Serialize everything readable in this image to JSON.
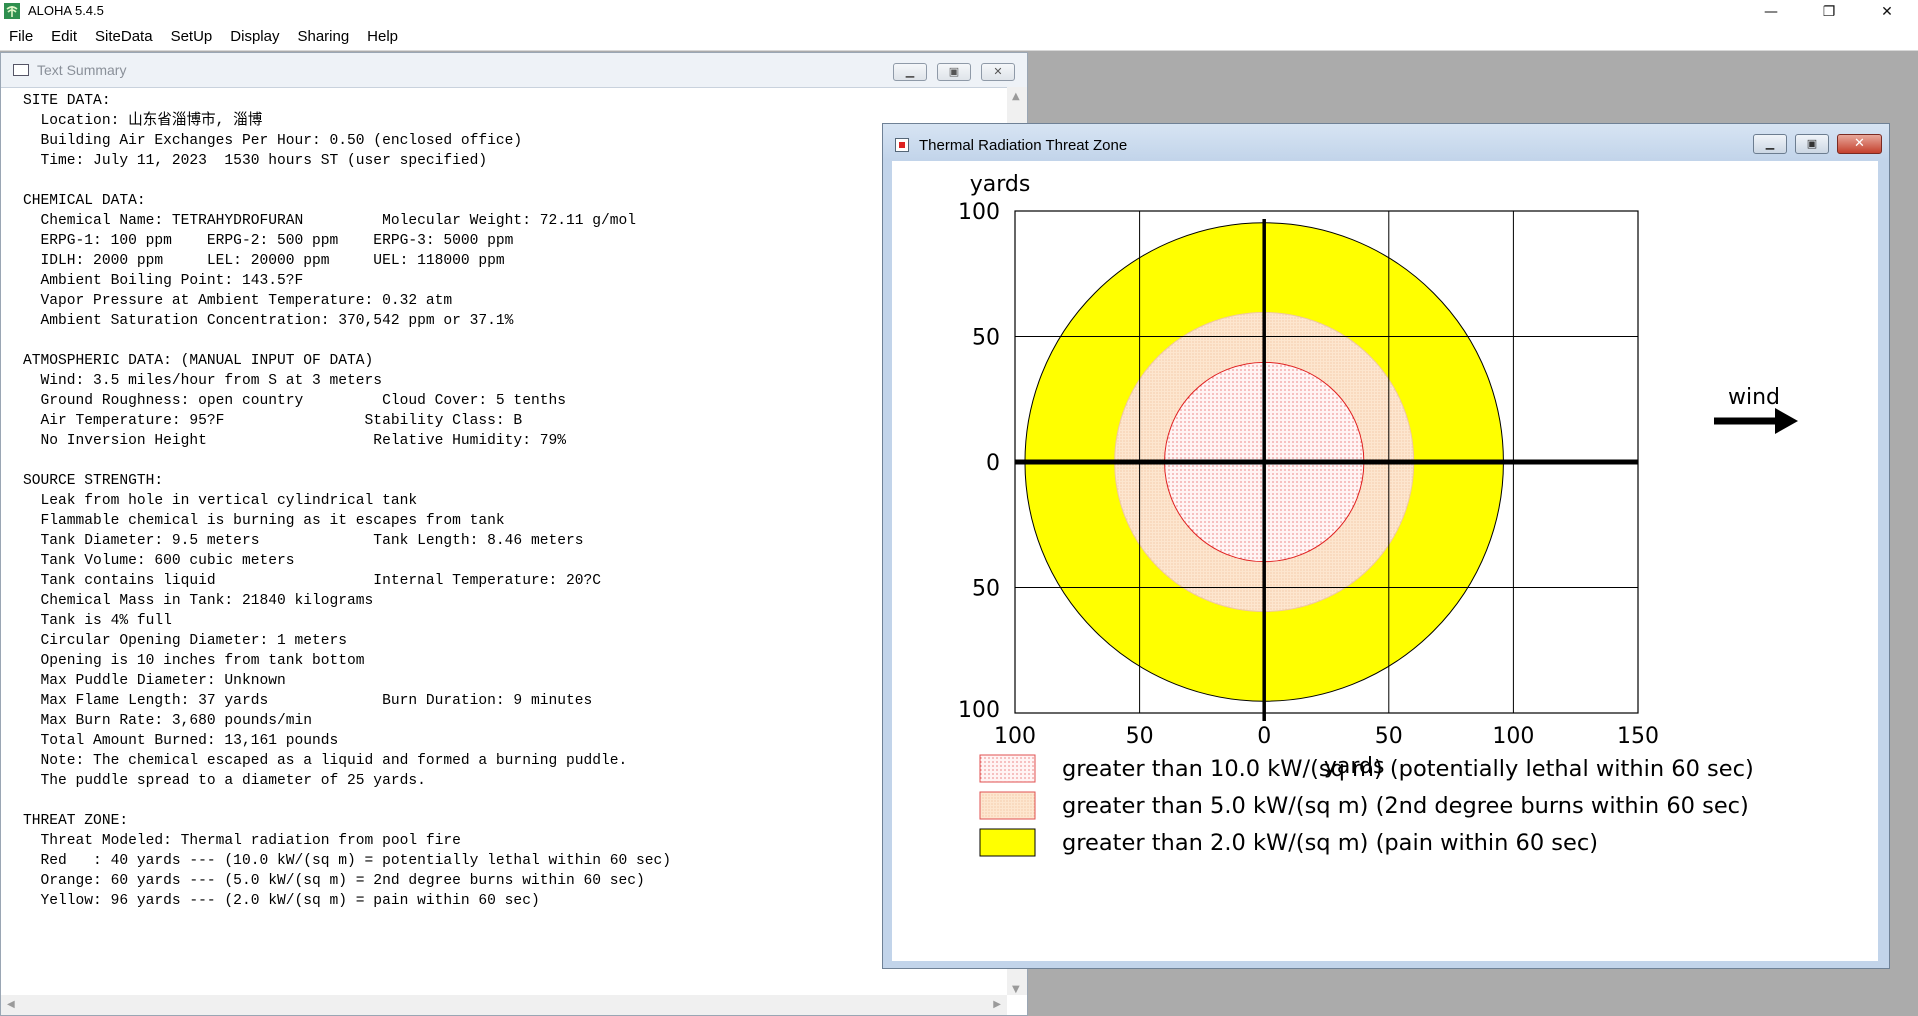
{
  "app": {
    "title": "ALOHA 5.4.5",
    "controls": {
      "minimize": "—",
      "maximize": "❐",
      "close": "✕"
    }
  },
  "menu": [
    "File",
    "Edit",
    "SiteData",
    "SetUp",
    "Display",
    "Sharing",
    "Help"
  ],
  "text_summary": {
    "title": "Text Summary",
    "lines": [
      "SITE DATA:",
      "  Location: 山东省淄博市, 淄博",
      "  Building Air Exchanges Per Hour: 0.50 (enclosed office)",
      "  Time: July 11, 2023  1530 hours ST (user specified)",
      "",
      "CHEMICAL DATA:",
      "  Chemical Name: TETRAHYDROFURAN         Molecular Weight: 72.11 g/mol",
      "  ERPG-1: 100 ppm    ERPG-2: 500 ppm    ERPG-3: 5000 ppm",
      "  IDLH: 2000 ppm     LEL: 20000 ppm     UEL: 118000 ppm",
      "  Ambient Boiling Point: 143.5?F",
      "  Vapor Pressure at Ambient Temperature: 0.32 atm",
      "  Ambient Saturation Concentration: 370,542 ppm or 37.1%",
      "",
      "ATMOSPHERIC DATA: (MANUAL INPUT OF DATA)",
      "  Wind: 3.5 miles/hour from S at 3 meters",
      "  Ground Roughness: open country         Cloud Cover: 5 tenths",
      "  Air Temperature: 95?F                Stability Class: B",
      "  No Inversion Height                   Relative Humidity: 79%",
      "",
      "SOURCE STRENGTH:",
      "  Leak from hole in vertical cylindrical tank",
      "  Flammable chemical is burning as it escapes from tank",
      "  Tank Diameter: 9.5 meters             Tank Length: 8.46 meters",
      "  Tank Volume: 600 cubic meters",
      "  Tank contains liquid                  Internal Temperature: 20?C",
      "  Chemical Mass in Tank: 21840 kilograms",
      "  Tank is 4% full",
      "  Circular Opening Diameter: 1 meters",
      "  Opening is 10 inches from tank bottom",
      "  Max Puddle Diameter: Unknown",
      "  Max Flame Length: 37 yards             Burn Duration: 9 minutes",
      "  Max Burn Rate: 3,680 pounds/min",
      "  Total Amount Burned: 13,161 pounds",
      "  Note: The chemical escaped as a liquid and formed a burning puddle.",
      "  The puddle spread to a diameter of 25 yards.",
      "",
      "THREAT ZONE:",
      "  Threat Modeled: Thermal radiation from pool fire",
      "  Red   : 40 yards --- (10.0 kW/(sq m) = potentially lethal within 60 sec)",
      "  Orange: 60 yards --- (5.0 kW/(sq m) = 2nd degree burns within 60 sec)",
      "  Yellow: 96 yards --- (2.0 kW/(sq m) = pain within 60 sec)"
    ]
  },
  "threat_window": {
    "title": "Thermal Radiation Threat Zone",
    "wind_label": "wind"
  },
  "chart_data": {
    "type": "threat-zone",
    "ylabel_top": "yards",
    "xlabel": "yards",
    "xlim": [
      -100,
      150
    ],
    "ylim": [
      -100,
      100
    ],
    "x_tick_labels": [
      {
        "value": -100,
        "label": "100"
      },
      {
        "value": -50,
        "label": "50"
      },
      {
        "value": 0,
        "label": "0"
      },
      {
        "value": 50,
        "label": "50"
      },
      {
        "value": 100,
        "label": "100"
      },
      {
        "value": 150,
        "label": "150"
      }
    ],
    "y_tick_labels": [
      {
        "value": 100,
        "label": "100"
      },
      {
        "value": 50,
        "label": "50"
      },
      {
        "value": 0,
        "label": "0"
      },
      {
        "value": -50,
        "label": "50"
      },
      {
        "value": -100,
        "label": "100"
      }
    ],
    "grid": true,
    "zones": [
      {
        "radius_yards": 96,
        "fill": "#ffff00",
        "stroke": "#000000",
        "pattern": "solid",
        "legend": "greater than 2.0 kW/(sq m) (pain within 60 sec)"
      },
      {
        "radius_yards": 60,
        "fill": "#fbdcc0",
        "stroke": "#f0c8a0",
        "pattern": "orange-dots",
        "legend": "greater than 5.0 kW/(sq m) (2nd degree burns within 60 sec)"
      },
      {
        "radius_yards": 40,
        "fill": "#fff2f2",
        "stroke": "#e02020",
        "pattern": "red-dots",
        "legend": "greater than 10.0 kW/(sq m) (potentially lethal within 60 sec)"
      }
    ],
    "legend_order": [
      2,
      1,
      0
    ]
  }
}
